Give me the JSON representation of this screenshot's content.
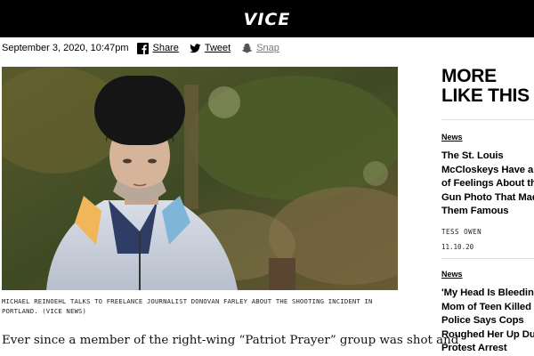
{
  "header": {
    "logo": "VICE"
  },
  "article": {
    "date": "September 3, 2020, 10:47pm",
    "share": [
      {
        "label": "Share",
        "icon": "facebook-icon"
      },
      {
        "label": "Tweet",
        "icon": "twitter-icon"
      },
      {
        "label": "Snap",
        "icon": "snapchat-icon"
      }
    ],
    "caption_line1": "MICHAEL REINOEHL TALKS TO FREELANCE JOURNALIST DONOVAN FARLEY ABOUT THE SHOOTING INCIDENT IN",
    "caption_line2": "PORTLAND. (VICE NEWS)",
    "lead_text": "Ever since a member of the right-wing “Patriot Prayer” group was shot and"
  },
  "sidebar": {
    "title_line1": "MORE",
    "title_line2": "LIKE THIS",
    "cards": [
      {
        "category": "News",
        "headline_lines": [
          "The St. Louis",
          "McCloskeys Have a L",
          "of Feelings About the",
          "Gun Photo That Mad",
          "Them Famous"
        ],
        "author": "TESS OWEN",
        "date": "11.10.20"
      },
      {
        "category": "News",
        "headline_lines": [
          "'My Head Is Bleeding",
          "Mom of Teen Killed b",
          "Police Says Cops",
          "Roughed Her Up Dur",
          "Protest Arrest"
        ]
      }
    ]
  },
  "colors": {
    "topbar": "#000000",
    "text": "#000000",
    "muted": "#777777"
  }
}
